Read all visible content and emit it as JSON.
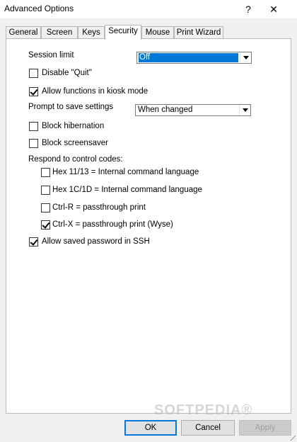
{
  "window": {
    "title": "Advanced Options",
    "help_glyph": "?",
    "close_glyph": "✕"
  },
  "tabs": [
    {
      "label": "General"
    },
    {
      "label": "Screen"
    },
    {
      "label": "Keys"
    },
    {
      "label": "Security",
      "active": true
    },
    {
      "label": "Mouse"
    },
    {
      "label": "Print Wizard"
    }
  ],
  "security": {
    "session_limit": {
      "label": "Session limit",
      "value": "Off"
    },
    "disable_quit": {
      "label": "Disable \"Quit\"",
      "checked": false
    },
    "allow_kiosk": {
      "label": "Allow functions in kiosk mode",
      "checked": true
    },
    "prompt_save": {
      "label": "Prompt to save settings",
      "value": "When changed"
    },
    "block_hibernation": {
      "label": "Block hibernation",
      "checked": false
    },
    "block_screensaver": {
      "label": "Block screensaver",
      "checked": false
    },
    "respond_label": "Respond to control codes:",
    "control_codes": [
      {
        "label": "Hex 11/13 = Internal command language",
        "checked": false
      },
      {
        "label": "Hex 1C/1D = Internal command language",
        "checked": false
      },
      {
        "label": "Ctrl-R = passthrough print",
        "checked": false
      },
      {
        "label": "Ctrl-X = passthrough print (Wyse)",
        "checked": true
      }
    ],
    "allow_saved_password": {
      "label": "Allow saved password in SSH",
      "checked": true
    }
  },
  "buttons": {
    "ok": "OK",
    "cancel": "Cancel",
    "apply": "Apply"
  },
  "watermark": "SOFTPEDIA®",
  "colors": {
    "accent": "#0078d7",
    "background": "#f0f0f0",
    "panel": "#ffffff"
  }
}
